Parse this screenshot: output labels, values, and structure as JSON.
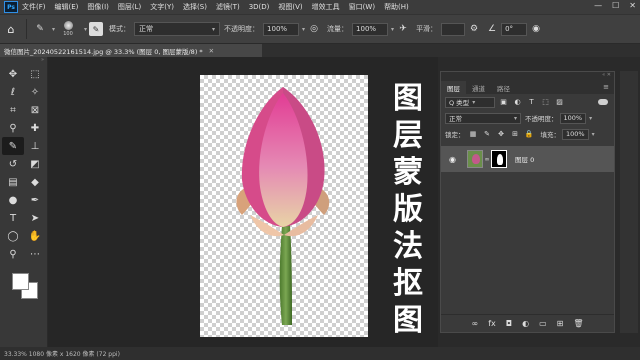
{
  "menubar": {
    "logo": "Ps",
    "items": [
      "文件(F)",
      "编辑(E)",
      "图像(I)",
      "图层(L)",
      "文字(Y)",
      "选择(S)",
      "滤镜(T)",
      "3D(D)",
      "视图(V)",
      "增效工具",
      "窗口(W)",
      "帮助(H)"
    ],
    "controls": [
      "—",
      "☐",
      "✕"
    ]
  },
  "options": {
    "brush_size": "100",
    "mode_label": "模式：",
    "mode_value": "正常",
    "opacity_label": "不透明度：",
    "opacity_value": "100%",
    "flow_label": "流量：",
    "flow_value": "100%",
    "smoothing_label": "平滑：",
    "angle_value": "0°"
  },
  "document": {
    "tab_title": "微信图片_20240522161514.jpg @ 33.3% (图层 0, 图层蒙版/8) *",
    "close": "✕"
  },
  "overlay": {
    "title_chars": [
      "图",
      "层",
      "蒙",
      "版",
      "法",
      "抠",
      "图"
    ]
  },
  "status": {
    "text": "33.33%    1080 像素 x 1620 像素 (72 ppi)"
  },
  "layers_panel": {
    "tabs": [
      "图层",
      "通道",
      "路径"
    ],
    "filter_label": "Q 类型",
    "blend_mode": "正常",
    "opacity_label": "不透明度：",
    "opacity_value": "100%",
    "lock_label": "锁定：",
    "fill_label": "填充：",
    "fill_value": "100%",
    "layer_name": "图层 0"
  },
  "colors": {
    "accent": "#31a8ff",
    "canvas_bg": "#262626",
    "panel_bg": "#3a3a3a",
    "selected_layer": "#555555"
  }
}
